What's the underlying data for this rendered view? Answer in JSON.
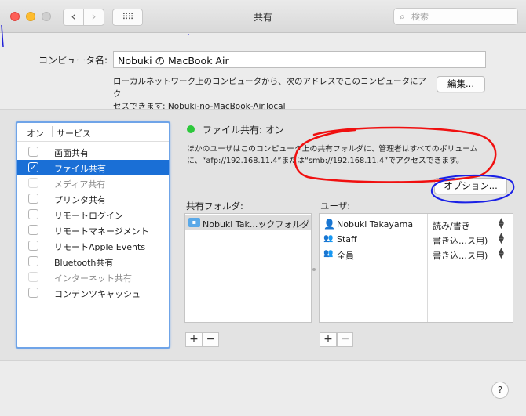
{
  "window": {
    "title": "共有",
    "search_placeholder": "検索"
  },
  "nav": {
    "back": "‹",
    "forward": "›",
    "grid": "⠿⠿"
  },
  "computer_name": {
    "label": "コンピュータ名:",
    "value": "Nobuki の MacBook Air",
    "description_line1": "ローカルネットワーク上のコンピュータから、次のアドレスでこのコンピュータにアク",
    "description_line2": "セスできます: Nobuki-no-MacBook-Air.local",
    "edit_button": "編集..."
  },
  "services": {
    "header_on": "オン",
    "header_service": "サービス",
    "items": [
      {
        "label": "画面共有",
        "checked": false,
        "enabled": true
      },
      {
        "label": "ファイル共有",
        "checked": true,
        "enabled": true,
        "selected": true
      },
      {
        "label": "メディア共有",
        "checked": false,
        "enabled": false
      },
      {
        "label": "プリンタ共有",
        "checked": false,
        "enabled": true
      },
      {
        "label": "リモートログイン",
        "checked": false,
        "enabled": true
      },
      {
        "label": "リモートマネージメント",
        "checked": false,
        "enabled": true
      },
      {
        "label": "リモートApple Events",
        "checked": false,
        "enabled": true
      },
      {
        "label": "Bluetooth共有",
        "checked": false,
        "enabled": true
      },
      {
        "label": "インターネット共有",
        "checked": false,
        "enabled": false
      },
      {
        "label": "コンテンツキャッシュ",
        "checked": false,
        "enabled": true
      }
    ]
  },
  "status": {
    "title": "ファイル共有: オン",
    "description_line1": "ほかのユーザはこのコンピュータ上の共有フォルダに、管理者はすべてのボリューム",
    "description_line2": "に、“afp://192.168.11.4”または“smb://192.168.11.4”でアクセスできます。",
    "options_button": "オプション...",
    "status_color": "#2cc83b"
  },
  "shared_folders": {
    "label": "共有フォルダ:",
    "items": [
      "Nobuki Tak...ックフォルダ"
    ],
    "add": "+",
    "remove": "−"
  },
  "users": {
    "label": "ユーザ:",
    "items": [
      {
        "name": "Nobuki Takayama",
        "permission": "読み/書き",
        "icon": "person-icon"
      },
      {
        "name": "Staff",
        "permission": "書き込…ス用)",
        "icon": "group-icon"
      },
      {
        "name": "全員",
        "permission": "書き込…ス用)",
        "icon": "everyone-icon"
      }
    ],
    "add": "+",
    "remove": "−"
  },
  "help": "?",
  "accent": "#1a6fd6"
}
